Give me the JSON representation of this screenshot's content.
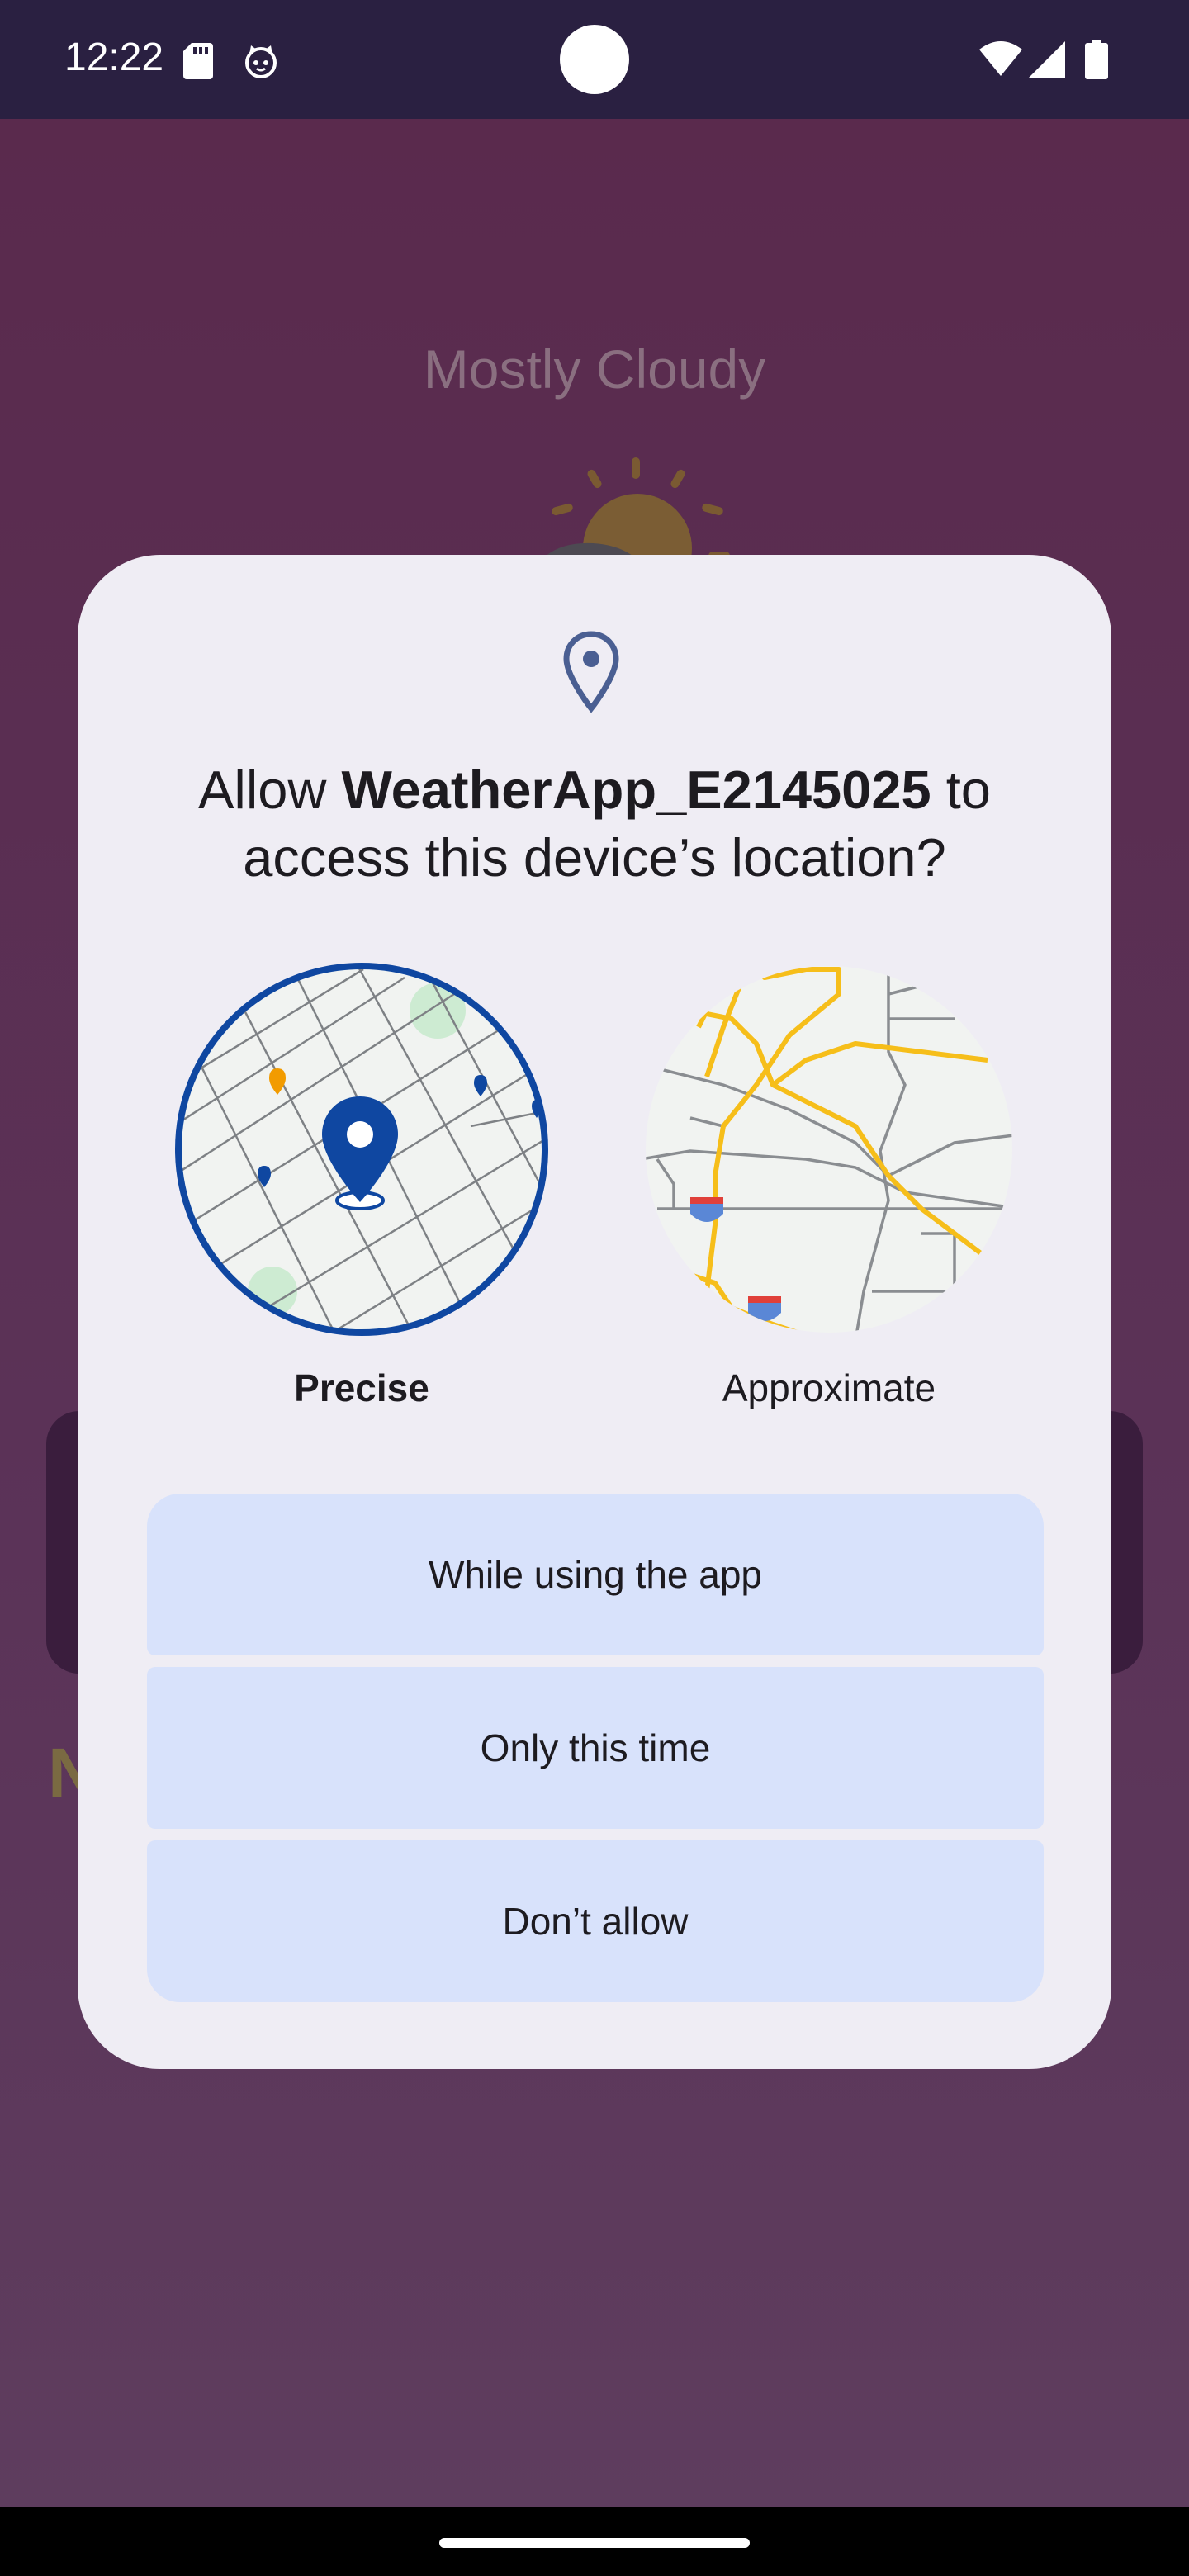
{
  "status_bar": {
    "time": "12:22",
    "icons": [
      "sd-card-icon",
      "cat-icon",
      "wifi-icon",
      "signal-icon",
      "battery-icon"
    ]
  },
  "background_app": {
    "condition": "Mostly Cloudy",
    "partial_text": "N",
    "icon": "partly-cloudy-icon"
  },
  "dialog": {
    "icon": "location-pin-icon",
    "title_prefix": "Allow ",
    "app_name": "WeatherApp_E2145025",
    "title_suffix": " to access this device’s location?",
    "options": {
      "precise_label": "Precise",
      "approximate_label": "Approximate",
      "selected": "Precise"
    },
    "buttons": {
      "while_using": "While using the app",
      "only_this_time": "Only this time",
      "dont_allow": "Don’t allow"
    }
  },
  "colors": {
    "accent": "#0f47a1",
    "button_bg": "#d8e2fb",
    "dialog_bg": "#efedf4",
    "scrim_bg": "#5a2a4d",
    "road_yellow": "#f6be1a"
  }
}
